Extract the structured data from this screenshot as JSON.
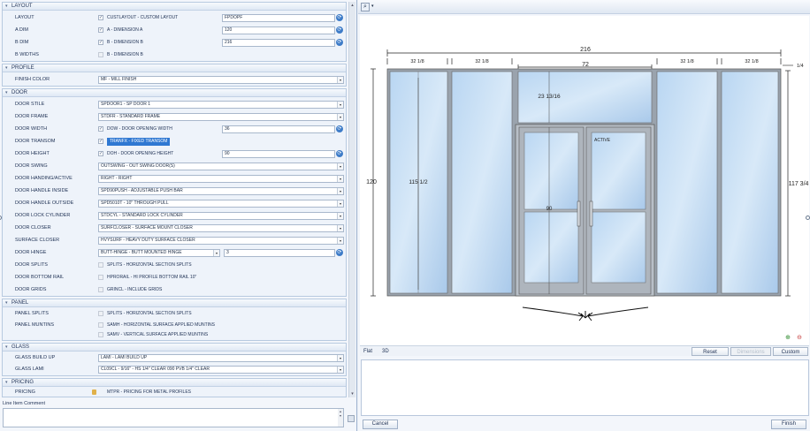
{
  "sections": {
    "layout": "LAYOUT",
    "profile": "PROFILE",
    "door": "DOOR",
    "panel": "PANEL",
    "glass": "GLASS",
    "pricing": "PRICING"
  },
  "layout": {
    "layout_label": "LAYOUT",
    "layout_text": "CUSTLAYOUT - CUSTOM LAYOUT",
    "layout_value": "FPDOPF",
    "a_dim_label": "A DIM",
    "a_dim_text": "A - DIMENSION A",
    "a_dim_value": "120",
    "b_dim_label": "B DIM",
    "b_dim_text": "B - DIMENSION B",
    "b_dim_value": "216",
    "b_widths_label": "B WIDTHS",
    "b_widths_text": "B - DIMENSION B"
  },
  "profile": {
    "finish_label": "FINISH COLOR",
    "finish_value": "MF - MILL FINISH"
  },
  "door": {
    "stile_label": "DOOR STILE",
    "stile_value": "SPDOOR1 - SP DOOR 1",
    "frame_label": "DOOR FRAME",
    "frame_value": "STDFR - STANDARD FRAME",
    "width_label": "DOOR WIDTH",
    "width_text": "DOW - DOOR OPENING WIDTH",
    "width_value": "36",
    "transom_label": "DOOR TRANSOM",
    "transom_text": "TRANFX - FIXED TRANSOM",
    "height_label": "DOOR HEIGHT",
    "height_text": "DOH - DOOR OPENING HEIGHT",
    "height_value": "90",
    "swing_label": "DOOR SWING",
    "swing_value": "OUTSWING - OUT SWING DOOR(S)",
    "handing_label": "DOOR HANDING/ACTIVE",
    "handing_value": "RIGHT - RIGHT",
    "handle_in_label": "DOOR HANDLE INSIDE",
    "handle_in_value": "SPD90PUSH - ADJUSTABLE PUSH BAR",
    "handle_out_label": "DOOR HANDLE OUTSIDE",
    "handle_out_value": "SPD5010T - 10\" THROUGH PULL",
    "lock_label": "DOOR LOCK CYLINDER",
    "lock_value": "STDCYL - STANDARD LOCK CYLINDER",
    "closer_label": "DOOR CLOSER",
    "closer_value": "SURFCLOSER - SURFACE MOUNT CLOSER",
    "surface_closer_label": "SURFACE CLOSER",
    "surface_closer_value": "HVYSURF - HEAVY DUTY SURFACE CLOSER",
    "hinge_label": "DOOR HINGE",
    "hinge_value": "BUTT-HINGE - BUTT MOUNTED HINGE",
    "hinge_count": "3",
    "splits_label": "DOOR SPLITS",
    "splits_text": "SPLITS - HORIZONTAL SECTION SPLITS",
    "bottom_rail_label": "DOOR BOTTOM RAIL",
    "bottom_rail_text": "HPRORAIL - HI PROFILE BOTTOM RAIL 10\"",
    "grids_label": "DOOR GRIDS",
    "grids_text": "GRINCL - INCLUDE GRIDS"
  },
  "panel": {
    "splits_label": "PANEL SPLITS",
    "splits_text": "SPLITS - HORIZONTAL SECTION SPLITS",
    "muntins_label": "PANEL MUNTINS",
    "muntins_h": "SAMH - HORIZONTAL SURFACE APPLIED MUNTINS",
    "muntins_v": "SAMV - VERTICAL SURFACE APPLIED MUNTINS"
  },
  "glass": {
    "build_label": "GLASS BUILD UP",
    "build_value": "LAMI - LAMI BUILD UP",
    "lami_label": "GLASS LAMI",
    "lami_value": "CL09CL - 9/16\" - HS 1/4\" CLEAR 090 PVB 1/4\" CLEAR"
  },
  "pricing": {
    "label": "PRICING",
    "value": "MTPR - PRICING FOR METAL PROFILES"
  },
  "comment_label": "Line Item Comment",
  "drawing": {
    "overall_width": "216",
    "panel_width": "32 1/8",
    "door_width": "72",
    "transom_height": "23 13/16",
    "active": "ACTIVE",
    "door_height": "90",
    "overall_height": "120",
    "sidelite_height": "115 1/2",
    "right_height": "117 3/4",
    "right_offset": "1/4"
  },
  "view": {
    "tab_flat": "Flat",
    "tab_3d": "3D",
    "reset": "Reset",
    "disabled_btn": "Dimensions",
    "custom": "Custom"
  },
  "bottom": {
    "cancel": "Cancel",
    "finish": "Finish"
  },
  "icons": {
    "refresh": "refresh-icon",
    "lock": "lock-icon",
    "zoom": "zoom-icon"
  }
}
